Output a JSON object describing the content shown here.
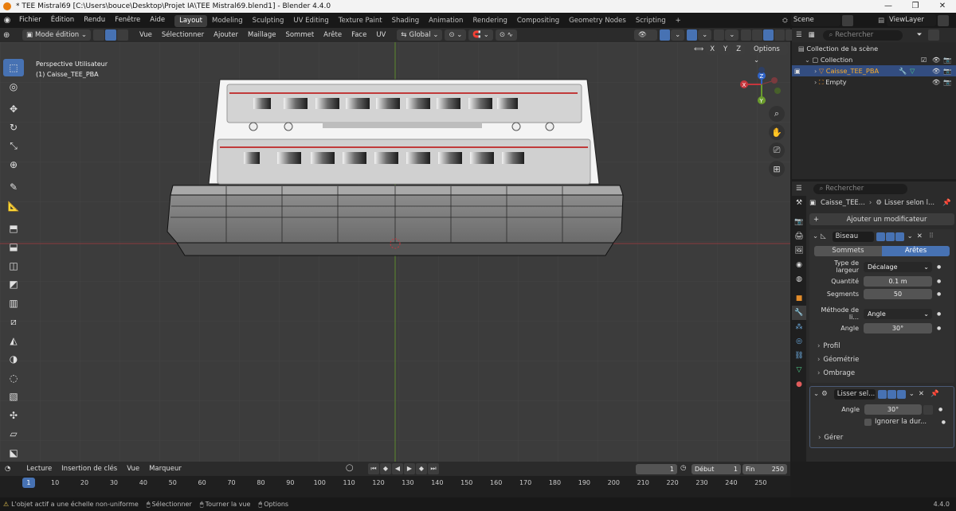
{
  "window": {
    "title": "* TEE Mistral69 [C:\\Users\\bouce\\Desktop\\Projet IA\\TEE Mistral69.blend1] - Blender 4.4.0",
    "controls": [
      "—",
      "❐",
      "✕"
    ]
  },
  "menubar": {
    "menus": [
      "Fichier",
      "Édition",
      "Rendu",
      "Fenêtre",
      "Aide"
    ],
    "workspaces": [
      "Layout",
      "Modeling",
      "Sculpting",
      "UV Editing",
      "Texture Paint",
      "Shading",
      "Animation",
      "Rendering",
      "Compositing",
      "Geometry Nodes",
      "Scripting"
    ],
    "active_workspace": "Layout",
    "add_workspace": "+",
    "scene_label": "Scene",
    "view_layer_label": "ViewLayer"
  },
  "viewport_header": {
    "mode": "Mode édition",
    "menus": [
      "Vue",
      "Sélectionner",
      "Ajouter",
      "Maillage",
      "Sommet",
      "Arête",
      "Face",
      "UV"
    ],
    "orientation": "Global",
    "axes": [
      "X",
      "Y",
      "Z"
    ],
    "options": "Options"
  },
  "viewport": {
    "view_name": "Perspective Utilisateur",
    "object_name": "(1) Caisse_TEE_PBA",
    "gizmo": {
      "x": "X",
      "y": "Y",
      "z": "Z"
    }
  },
  "toolbar": {
    "tools": [
      "select-box",
      "cursor",
      "move",
      "rotate",
      "scale",
      "transform",
      "annotate",
      "measure",
      "add-cube",
      "extrude",
      "inset",
      "bevel",
      "loop-cut",
      "knife",
      "poly-build",
      "spin",
      "smooth",
      "edge-slide",
      "shrink-fatten",
      "shear",
      "rip"
    ]
  },
  "outliner": {
    "search_placeholder": "Rechercher",
    "rows": [
      {
        "label": "Collection de la scène",
        "indent": 0
      },
      {
        "label": "Collection",
        "indent": 1
      },
      {
        "label": "Caisse_TEE_PBA",
        "indent": 2,
        "selected": true
      },
      {
        "label": "Empty",
        "indent": 2
      }
    ]
  },
  "properties": {
    "search_placeholder": "Rechercher",
    "breadcrumb": [
      "Caisse_TEE...",
      "Lisser selon l..."
    ],
    "add_modifier": "Ajouter un modificateur",
    "bevel": {
      "name": "Biseau",
      "tabs": [
        "Sommets",
        "Arêtes"
      ],
      "active_tab": "Arêtes",
      "fields": [
        {
          "label": "Type de largeur",
          "value": "Décalage",
          "kind": "dropdown"
        },
        {
          "label": "Quantité",
          "value": "0.1 m",
          "kind": "number"
        },
        {
          "label": "Segments",
          "value": "50",
          "kind": "number"
        },
        {
          "label": "Méthode de li...",
          "value": "Angle",
          "kind": "dropdown"
        },
        {
          "label": "Angle",
          "value": "30°",
          "kind": "number"
        }
      ],
      "subpanels": [
        "Profil",
        "Géométrie",
        "Ombrage"
      ]
    },
    "smooth": {
      "name": "Lisser sel...",
      "angle_label": "Angle",
      "angle_value": "30°",
      "ignore_label": "Ignorer la dur...",
      "subpanel": "Gérer"
    }
  },
  "timeline": {
    "menus": [
      "Lecture",
      "Insertion de clés",
      "Vue",
      "Marqueur"
    ],
    "current_frame": "1",
    "start_label": "Début",
    "start_value": "1",
    "end_label": "Fin",
    "end_value": "250",
    "ticks": [
      "1",
      "10",
      "20",
      "30",
      "40",
      "50",
      "60",
      "70",
      "80",
      "90",
      "100",
      "110",
      "120",
      "130",
      "140",
      "150",
      "160",
      "170",
      "180",
      "190",
      "200",
      "210",
      "220",
      "230",
      "240",
      "250"
    ]
  },
  "statusbar": {
    "warning": "L'objet actif a une échelle non-uniforme",
    "hints": [
      "Sélectionner",
      "Tourner la vue",
      "Options"
    ],
    "version": "4.4.0"
  },
  "colors": {
    "accent": "#4772b3",
    "selected_orange": "#ffaf29",
    "axis_red": "#c7363d",
    "axis_green": "#6a9b2d",
    "axis_blue": "#2f64c9"
  }
}
